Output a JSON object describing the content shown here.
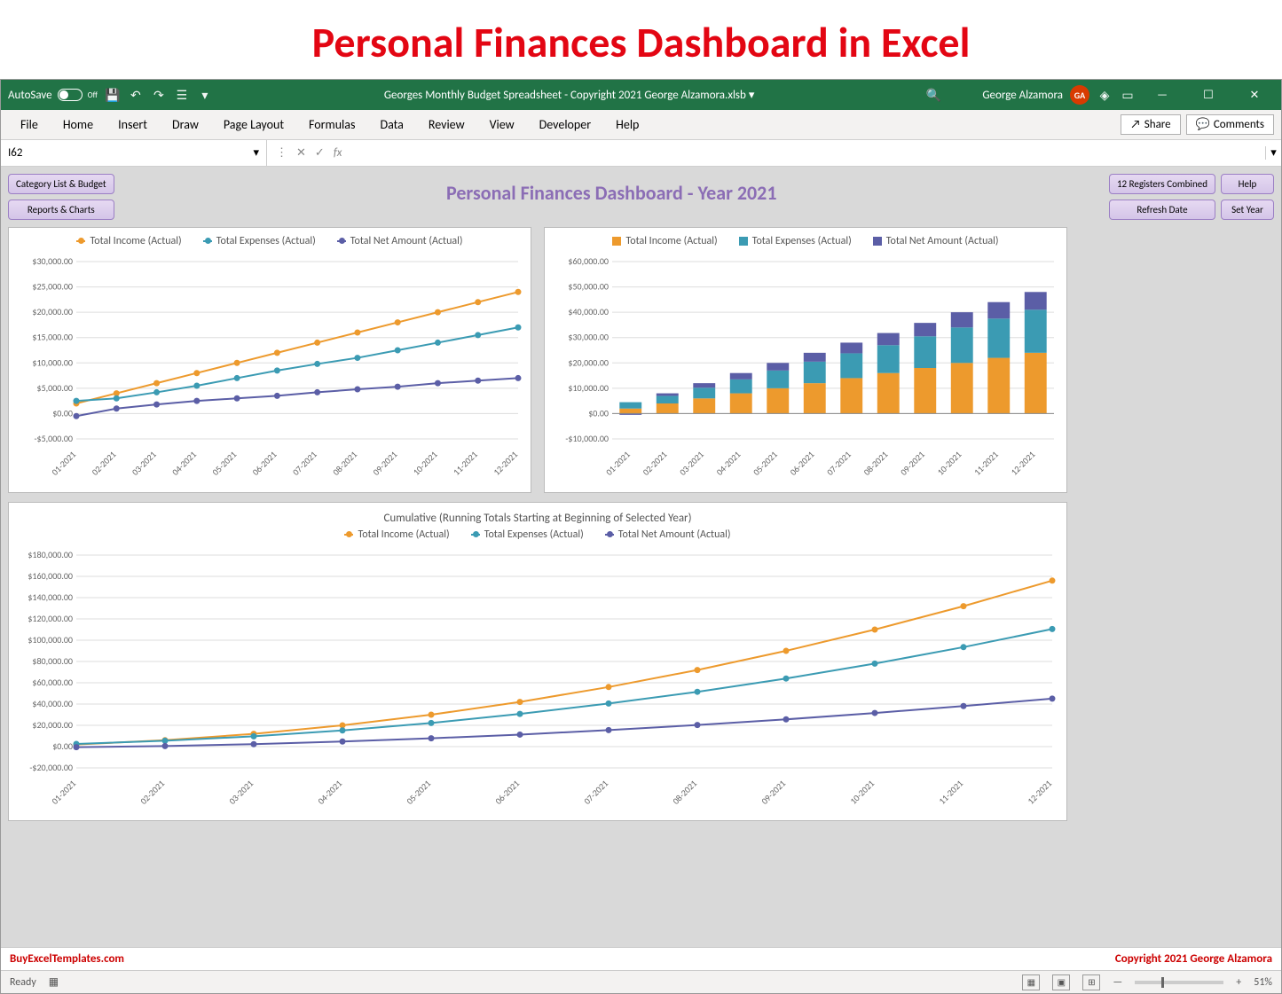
{
  "page_heading": "Personal Finances Dashboard in Excel",
  "titlebar": {
    "autosave_label": "AutoSave",
    "autosave_state": "Off",
    "filename": "Georges Monthly Budget Spreadsheet - Copyright 2021 George Alzamora.xlsb",
    "username": "George Alzamora",
    "initials": "GA"
  },
  "ribbon": {
    "tabs": [
      "File",
      "Home",
      "Insert",
      "Draw",
      "Page Layout",
      "Formulas",
      "Data",
      "Review",
      "View",
      "Developer",
      "Help"
    ],
    "share": "Share",
    "comments": "Comments"
  },
  "fx": {
    "namebox": "I62",
    "fx_label": "fx"
  },
  "dash": {
    "title": "Personal Finances Dashboard - Year 2021",
    "btn_category": "Category List & Budget",
    "btn_reports": "Reports & Charts",
    "btn_registers": "12 Registers Combined",
    "btn_refresh": "Refresh Date",
    "btn_help": "Help",
    "btn_setyear": "Set Year"
  },
  "legend_labels": {
    "income": "Total Income (Actual)",
    "expenses": "Total Expenses (Actual)",
    "net": "Total Net Amount (Actual)"
  },
  "chart3_title": "Cumulative (Running Totals Starting at Beginning of Selected Year)",
  "footer": {
    "left": "BuyExcelTemplates.com",
    "right": "Copyright 2021  George Alzamora"
  },
  "status": {
    "ready": "Ready",
    "zoom": "51%"
  },
  "colors": {
    "income": "#ed9a2d",
    "expenses": "#3b9bb3",
    "net": "#5b5ea6"
  },
  "chart_data": [
    {
      "type": "line",
      "title": "",
      "categories": [
        "01-2021",
        "02-2021",
        "03-2021",
        "04-2021",
        "05-2021",
        "06-2021",
        "07-2021",
        "08-2021",
        "09-2021",
        "10-2021",
        "11-2021",
        "12-2021"
      ],
      "series": [
        {
          "name": "Total Income (Actual)",
          "values": [
            2000,
            4000,
            6000,
            8000,
            10000,
            12000,
            14000,
            16000,
            18000,
            20000,
            22000,
            24000
          ]
        },
        {
          "name": "Total Expenses (Actual)",
          "values": [
            2500,
            3000,
            4200,
            5500,
            7000,
            8500,
            9800,
            11000,
            12500,
            14000,
            15500,
            17000
          ]
        },
        {
          "name": "Total Net Amount (Actual)",
          "values": [
            -500,
            1000,
            1800,
            2500,
            3000,
            3500,
            4200,
            4800,
            5300,
            6000,
            6500,
            7000
          ]
        }
      ],
      "ylabel": "",
      "xlabel": "",
      "ylim": [
        -5000,
        30000
      ],
      "y_ticks": [
        "-$5,000.00",
        "$0.00",
        "$5,000.00",
        "$10,000.00",
        "$15,000.00",
        "$20,000.00",
        "$25,000.00",
        "$30,000.00"
      ]
    },
    {
      "type": "bar",
      "stacked": true,
      "title": "",
      "categories": [
        "01-2021",
        "02-2021",
        "03-2021",
        "04-2021",
        "05-2021",
        "06-2021",
        "07-2021",
        "08-2021",
        "09-2021",
        "10-2021",
        "11-2021",
        "12-2021"
      ],
      "series": [
        {
          "name": "Total Income (Actual)",
          "values": [
            2000,
            4000,
            6000,
            8000,
            10000,
            12000,
            14000,
            16000,
            18000,
            20000,
            22000,
            24000
          ]
        },
        {
          "name": "Total Expenses (Actual)",
          "values": [
            2500,
            3000,
            4200,
            5500,
            7000,
            8500,
            9800,
            11000,
            12500,
            14000,
            15500,
            17000
          ]
        },
        {
          "name": "Total Net Amount (Actual)",
          "values": [
            -500,
            1000,
            1800,
            2500,
            3000,
            3500,
            4200,
            4800,
            5300,
            6000,
            6500,
            7000
          ]
        }
      ],
      "ylabel": "",
      "xlabel": "",
      "ylim": [
        -10000,
        60000
      ],
      "y_ticks": [
        "-$10,000.00",
        "$0.00",
        "$10,000.00",
        "$20,000.00",
        "$30,000.00",
        "$40,000.00",
        "$50,000.00",
        "$60,000.00"
      ]
    },
    {
      "type": "line",
      "title": "Cumulative (Running Totals Starting at Beginning of Selected Year)",
      "categories": [
        "01-2021",
        "02-2021",
        "03-2021",
        "04-2021",
        "05-2021",
        "06-2021",
        "07-2021",
        "08-2021",
        "09-2021",
        "10-2021",
        "11-2021",
        "12-2021"
      ],
      "series": [
        {
          "name": "Total Income (Actual)",
          "values": [
            2000,
            6000,
            12000,
            20000,
            30000,
            42000,
            56000,
            72000,
            90000,
            110000,
            132000,
            156000
          ]
        },
        {
          "name": "Total Expenses (Actual)",
          "values": [
            2500,
            5500,
            9700,
            15200,
            22200,
            30700,
            40500,
            51500,
            64000,
            78000,
            93500,
            110500
          ]
        },
        {
          "name": "Total Net Amount (Actual)",
          "values": [
            -500,
            500,
            2300,
            4800,
            7800,
            11300,
            15500,
            20300,
            25600,
            31600,
            38100,
            45100
          ]
        }
      ],
      "ylabel": "",
      "xlabel": "",
      "ylim": [
        -20000,
        180000
      ],
      "y_ticks": [
        "-$20,000.00",
        "$0.00",
        "$20,000.00",
        "$40,000.00",
        "$60,000.00",
        "$80,000.00",
        "$100,000.00",
        "$120,000.00",
        "$140,000.00",
        "$160,000.00",
        "$180,000.00"
      ]
    }
  ]
}
